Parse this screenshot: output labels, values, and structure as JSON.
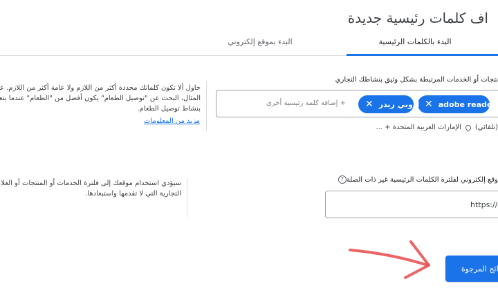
{
  "header": {
    "title": "اف كلمات رئيسية جديدة"
  },
  "tabs": [
    {
      "label": "البدء بالكلمات الرئيسية",
      "active": true
    },
    {
      "label": "البدء بموقع إلكتروني",
      "active": false
    }
  ],
  "keywords_section": {
    "prompt": "نتجات أو الخدمات المرتبطة بشكل وثيق بنشاطك التجاري",
    "chips": [
      {
        "label": "adobe reader",
        "remove_icon": "close-icon"
      },
      {
        "label": "ادوبي ريدر",
        "remove_icon": "close-icon"
      }
    ],
    "add_placeholder": "+ إضافة كلمة رئيسية أخرى",
    "language": "(تلقائي)",
    "location": "الإمارات العربية المتحدة + ...",
    "help_lines": [
      "حاول ألا تكون كلماتك محددة أكثر من اللازم ولا عامة أكثر من اللازم. عل",
      "المثال، البحث عن \"توصيل الطعام\" يكون أفضل من \"الطعام\" عندما يتعلق",
      "بنشاط توصيل الطعام."
    ],
    "help_link": "مزيد من المعلومات"
  },
  "website_section": {
    "prompt": "وقع إلكتروني لفلترة الكلمات الرئيسية غير ذات الصلة",
    "info_icon": "?",
    "url_value": "https://",
    "help_lines": [
      "سيؤدي استخدام موقعك إلى فلترة الخدمات أو المنتجات أو العلا",
      "التجارية التي لا تقدمها واستبعادها."
    ]
  },
  "actions": {
    "results_label": "النتائج المرجوة"
  },
  "colors": {
    "accent": "#1a73e8",
    "annotation": "#e84a4a"
  }
}
